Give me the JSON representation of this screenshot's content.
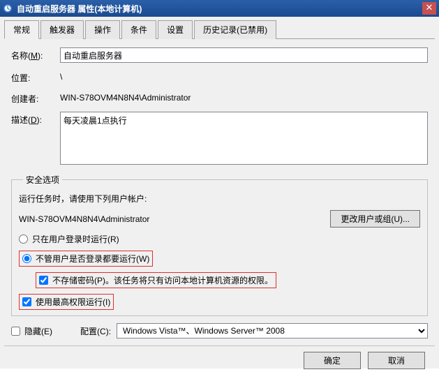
{
  "titlebar": {
    "title": "自动重启服务器 属性(本地计算机)"
  },
  "tabs": [
    {
      "label": "常规"
    },
    {
      "label": "触发器"
    },
    {
      "label": "操作"
    },
    {
      "label": "条件"
    },
    {
      "label": "设置"
    },
    {
      "label": "历史记录(已禁用)"
    }
  ],
  "general": {
    "name_label_pre": "名称(",
    "name_label_u": "M",
    "name_label_post": "):",
    "name_value": "自动重启服务器",
    "location_label": "位置:",
    "location_value": "\\",
    "creator_label": "创建者:",
    "creator_value": "WIN-S78OVM4N8N4\\Administrator",
    "desc_label_pre": "描述(",
    "desc_label_u": "D",
    "desc_label_post": "):",
    "desc_value": "每天凌晨1点执行"
  },
  "security": {
    "legend": "安全选项",
    "runas_prompt": "运行任务时，请使用下列用户帐户:",
    "runas_user": "WIN-S78OVM4N8N4\\Administrator",
    "change_user_btn_pre": "更改用户或组(",
    "change_user_btn_u": "U",
    "change_user_btn_post": ")...",
    "radio_logged_pre": "只在用户登录时运行(",
    "radio_logged_u": "R",
    "radio_logged_post": ")",
    "radio_always_pre": "不管用户是否登录都要运行(",
    "radio_always_u": "W",
    "radio_always_post": ")",
    "nopass_pre": "不存储密码(",
    "nopass_u": "P",
    "nopass_post": ")。该任务将只有访问本地计算机资源的权限。",
    "highest_pre": "使用最高权限运行(",
    "highest_u": "I",
    "highest_post": ")"
  },
  "bottom": {
    "hidden_pre": "隐藏(",
    "hidden_u": "E",
    "hidden_post": ")",
    "config_label_pre": "配置(",
    "config_label_u": "C",
    "config_label_post": "):",
    "config_value": "Windows Vista™、Windows Server™ 2008"
  },
  "buttons": {
    "ok": "确定",
    "cancel": "取消"
  }
}
